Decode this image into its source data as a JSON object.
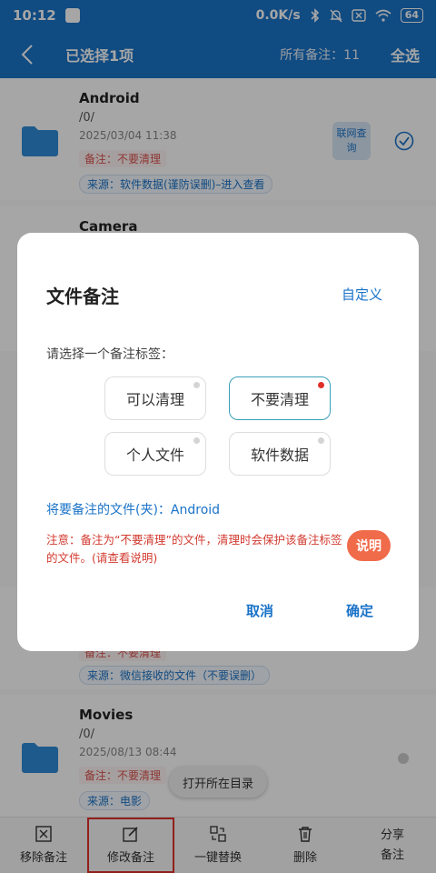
{
  "status_bar": {
    "time": "10:12",
    "network_speed": "0.0K/s",
    "battery": "64",
    "icons": [
      "app-notification-icon",
      "bluetooth-icon",
      "mute-icon",
      "sim-off-icon",
      "wifi-icon",
      "battery-icon"
    ]
  },
  "app_bar": {
    "title": "已选择1项",
    "count_label": "所有备注：11",
    "select_all": "全选",
    "accent_color": "#1a73c8"
  },
  "list": {
    "items": [
      {
        "name": "Android",
        "path": "/0/",
        "date": "2025/03/04 11:38",
        "note": "备注：不要清理",
        "source": "来源：软件数据(谨防误删)–进入查看",
        "lookup": "联网查询",
        "selected": true
      },
      {
        "name": "Camera"
      },
      {
        "note": "备注：不要清理",
        "source": "来源：微信接收的文件（不要误删）"
      },
      {
        "name": "Movies",
        "path": "/0/",
        "date": "2025/08/13 08:44",
        "note": "备注：不要清理",
        "source": "来源：电影",
        "selected": false
      }
    ]
  },
  "toast": {
    "text": "打开所在目录"
  },
  "toolbar": {
    "items": [
      {
        "label": "移除备注",
        "icon": "remove-box-icon"
      },
      {
        "label": "修改备注",
        "icon": "edit-icon",
        "highlighted": true
      },
      {
        "label": "一键替换",
        "icon": "replace-icon"
      },
      {
        "label": "删除",
        "icon": "trash-icon"
      },
      {
        "label": "分享\n备注",
        "icon": ""
      }
    ]
  },
  "dialog": {
    "title": "文件备注",
    "custom": "自定义",
    "prompt": "请选择一个备注标签：",
    "tags": [
      {
        "label": "可以清理",
        "selected": false
      },
      {
        "label": "不要清理",
        "selected": true
      },
      {
        "label": "个人文件",
        "selected": false
      },
      {
        "label": "软件数据",
        "selected": false
      }
    ],
    "target": "将要备注的文件(夹)：Android",
    "warning": "注意：备注为“不要清理”的文件，清理时会保护该备注标签的文件。(请查看说明)",
    "explain_button": "说明",
    "cancel": "取消",
    "ok": "确定",
    "explain_color": "#f06b4a",
    "warning_color": "#d23a2f"
  }
}
